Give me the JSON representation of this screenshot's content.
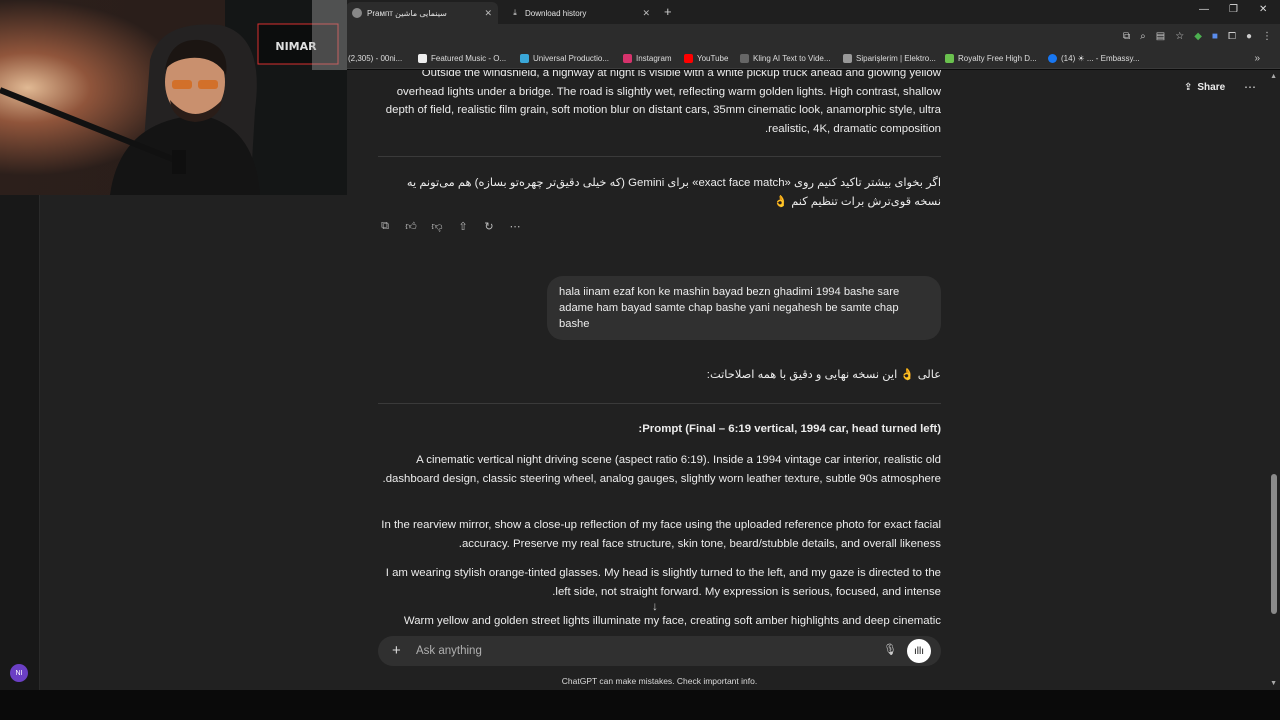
{
  "tabs": [
    {
      "title": "Рrампт سینمایی ماشین",
      "active": true
    },
    {
      "title": "Download history",
      "active": false
    }
  ],
  "window_controls": [
    "—",
    "❐",
    "✕"
  ],
  "bookmarks": [
    {
      "label": "(2,305) - 00ni..."
    },
    {
      "label": "Featured Music - O..."
    },
    {
      "label": "Universal Productio..."
    },
    {
      "label": "Instagram"
    },
    {
      "label": "YouTube"
    },
    {
      "label": "Kling AI Text to Vide..."
    },
    {
      "label": "Siparişlerim | Elektro..."
    },
    {
      "label": "Royalty Free High D..."
    },
    {
      "label": "(14) ☀ ... - Embassy..."
    }
  ],
  "header": {
    "share_label": "Share"
  },
  "avatar": {
    "initials": "NI"
  },
  "webcam": {
    "sign": "NIMAR"
  },
  "conversation": {
    "assistant_para_top": "Outside the windshield, a highway at night is visible with a white pickup truck ahead and glowing yellow overhead lights under a bridge. The road is slightly wet, reflecting warm golden lights. High contrast, shallow depth of field, realistic film grain, soft motion blur on distant cars, 35mm cinematic look, anamorphic style, ultra realistic, 4K, dramatic composition.",
    "assistant_followup": "اگر بخوای بیشتر تاکید کنیم روی «exact face match» برای Gemini (که خیلی دقیق‌تر چهره‌تو بسازه) هم می‌تونم یه نسخه قوی‌ترش برات تنظیم کنم 👌",
    "user_message": "hala iinam ezaf kon ke mashin bayad  bezn ghadimi 1994 bashe sare adame ham bayad samte chap bashe  yani negahesh be samte chap bashe",
    "assistant_intro": "عالی 👌 این نسخه نهایی و دقیق با همه اصلاحاتت:",
    "prompt_heading": "Prompt (Final – 6:19 vertical, 1994 car, head turned left):",
    "prompt_paragraphs": [
      "A cinematic vertical night driving scene (aspect ratio 6:19). Inside a 1994 vintage car interior, realistic old dashboard design, classic steering wheel, analog gauges, slightly worn leather texture, subtle 90s atmosphere.",
      "In the rearview mirror, show a close-up reflection of my face using the uploaded reference photo for exact facial accuracy. Preserve my real face structure, skin tone, beard/stubble details, and overall likeness.",
      "I am wearing stylish orange-tinted glasses. My head is slightly turned to the left, and my gaze is directed to the left side, not straight forward. My expression is serious, focused, and intense.",
      "Warm yellow and golden street lights illuminate my face, creating soft amber highlights and deep cinematic"
    ]
  },
  "composer": {
    "placeholder": "Ask anything"
  },
  "disclaimer": "ChatGPT can make mistakes. Check important info."
}
